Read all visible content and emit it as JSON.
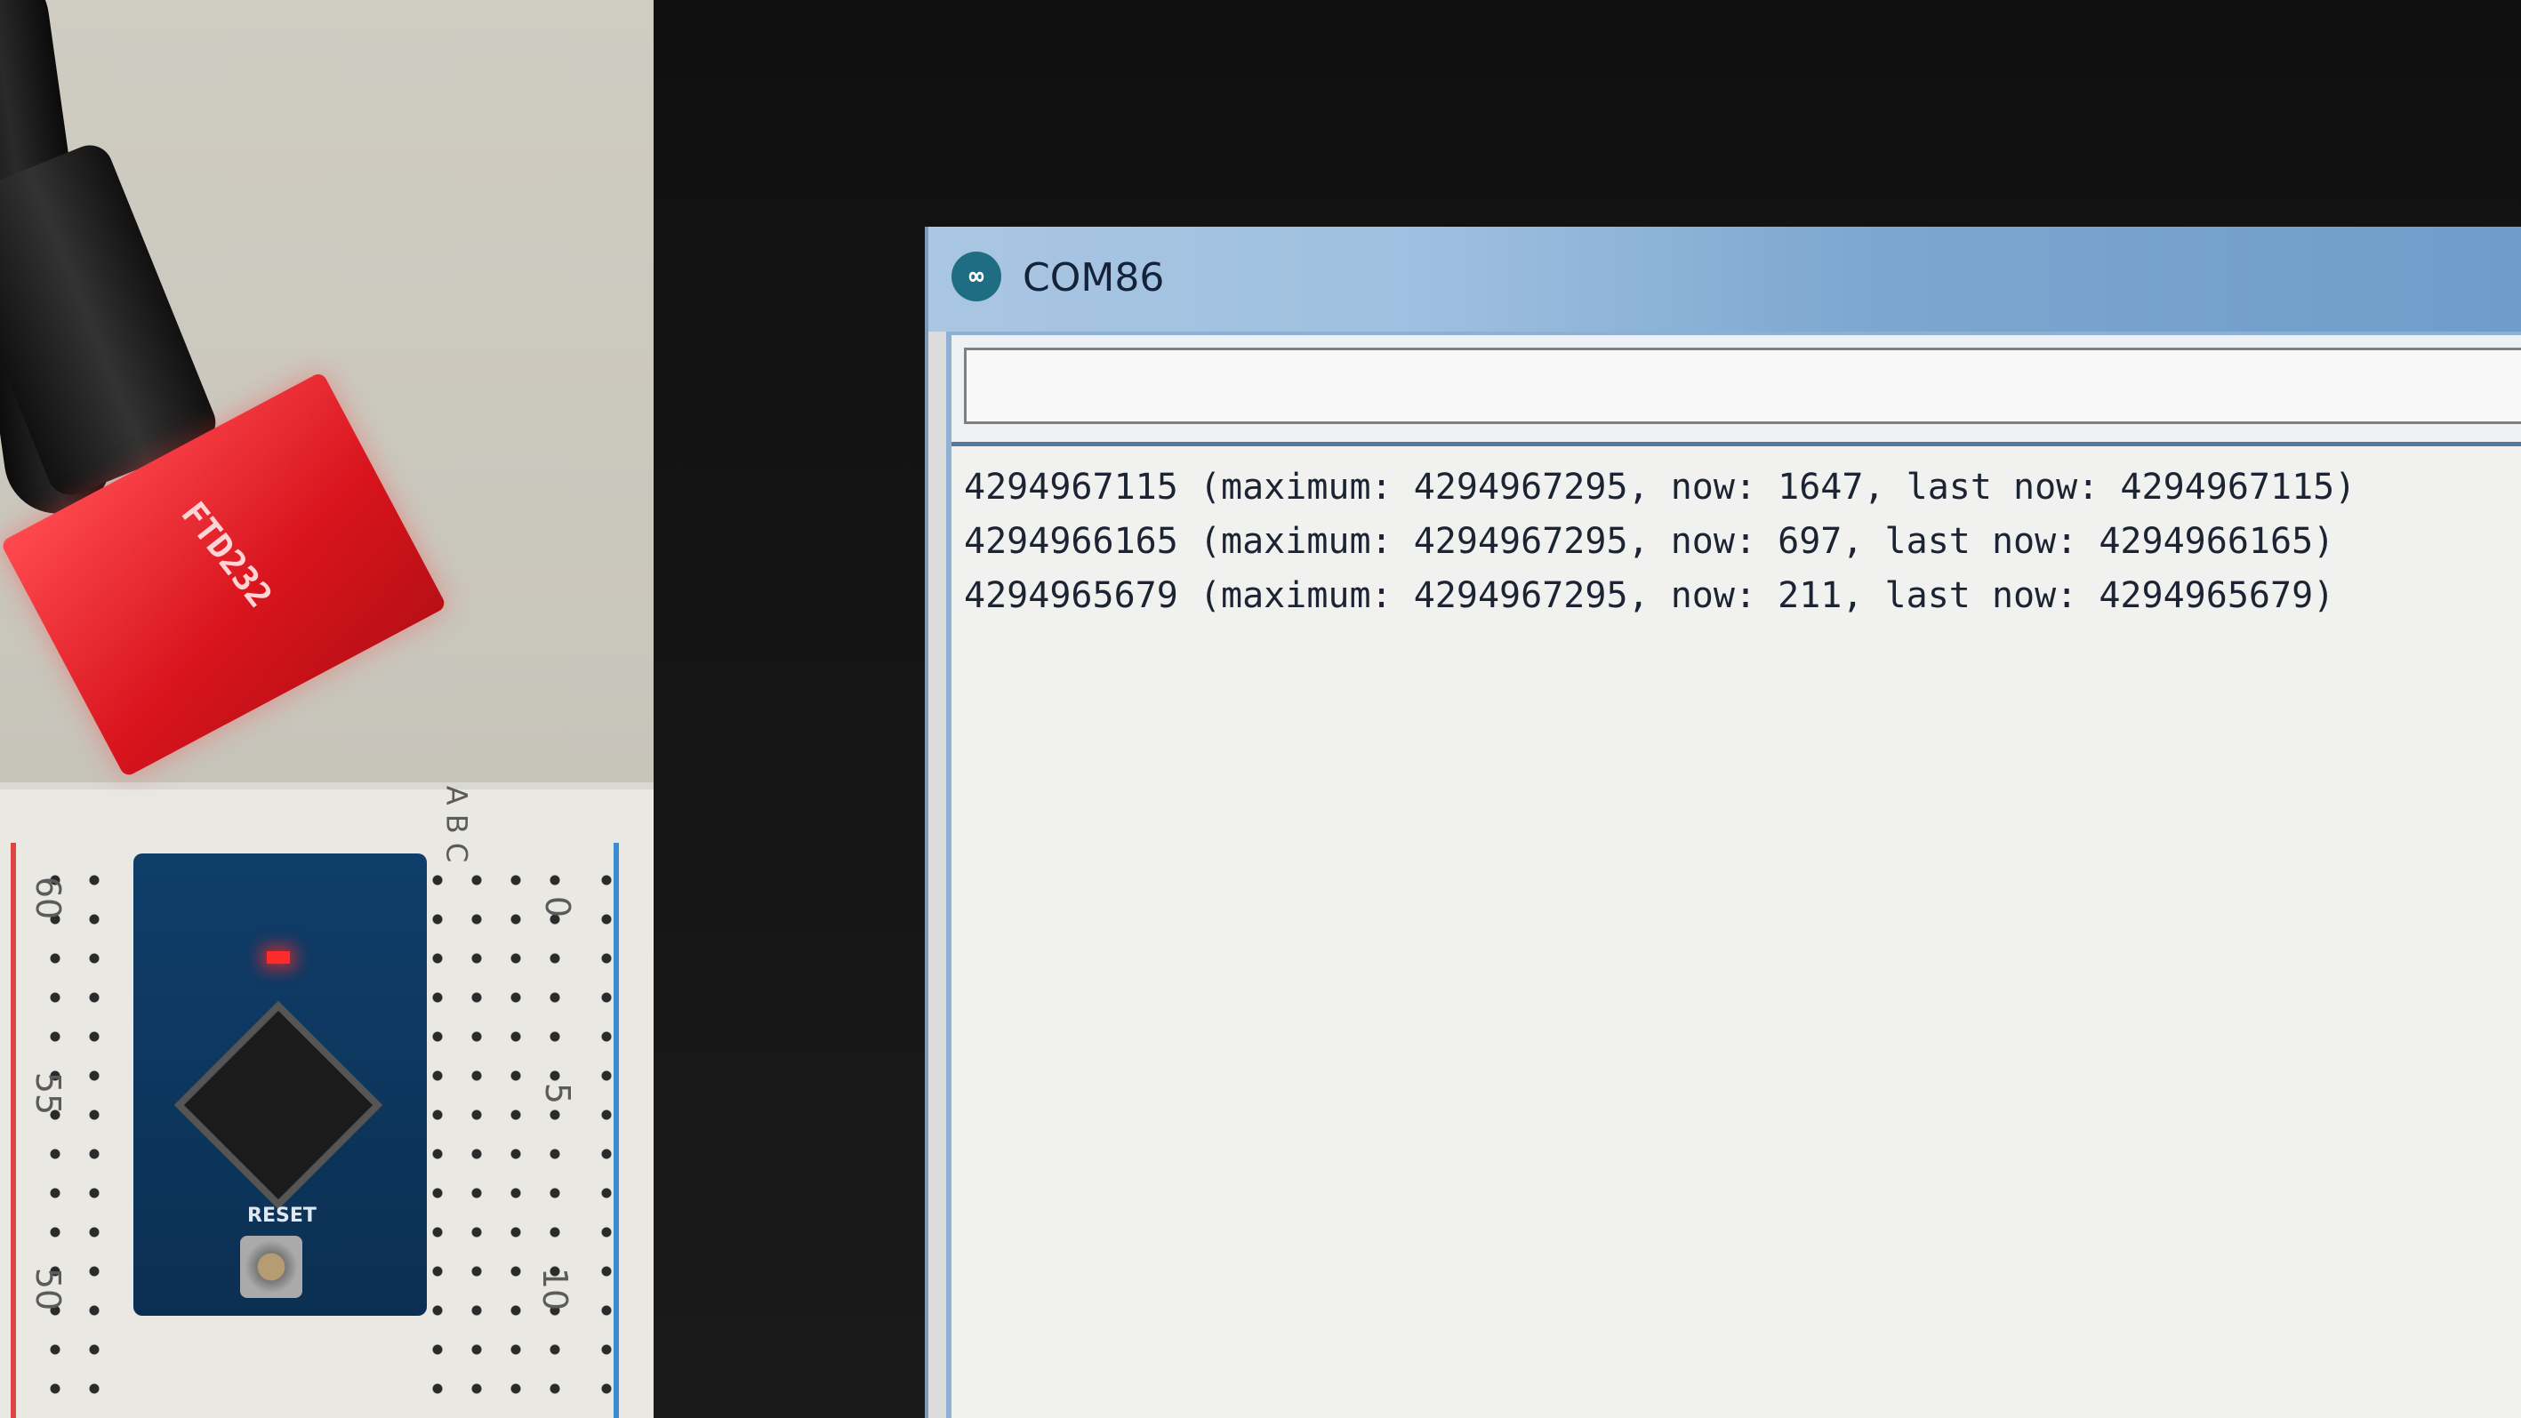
{
  "window": {
    "title": "COM86",
    "icon": "arduino-infinity-icon",
    "icon_glyph": "∞"
  },
  "send_input": {
    "value": ""
  },
  "output": {
    "lines": [
      "4294967115 (maximum: 4294967295, now: 1647, last now: 4294967115)",
      "4294966165 (maximum: 4294967295, now: 697, last now: 4294966165)",
      "4294965679 (maximum: 4294967295, now: 211, last now: 4294965679)"
    ]
  },
  "hardware": {
    "ftdi_label": "FTD232",
    "reset_label": "RESET",
    "breadboard_row_numbers": [
      "60",
      "55",
      "50"
    ],
    "breadboard_col_numbers": [
      "0",
      "5",
      "10"
    ],
    "breadboard_col_letters": "A B C"
  },
  "colors": {
    "titlebar": "#9fc0e0",
    "ftdi_board": "#d8141d",
    "pro_mini_board": "#0f3e6a",
    "led": "#ff2a2a"
  }
}
